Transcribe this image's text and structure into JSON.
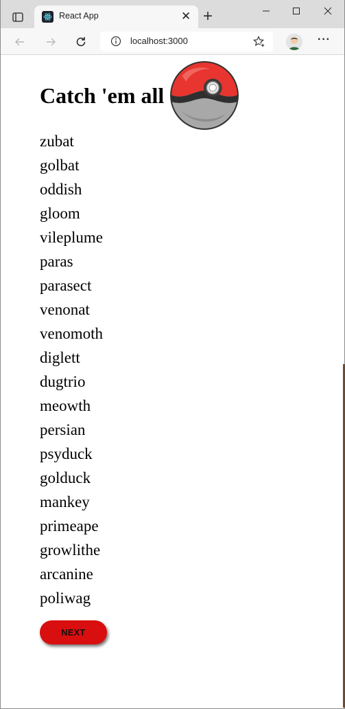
{
  "browser": {
    "tab_title": "React App",
    "url": "localhost:3000"
  },
  "page": {
    "title": "Catch 'em all",
    "pokemon": [
      "zubat",
      "golbat",
      "oddish",
      "gloom",
      "vileplume",
      "paras",
      "parasect",
      "venonat",
      "venomoth",
      "diglett",
      "dugtrio",
      "meowth",
      "persian",
      "psyduck",
      "golduck",
      "mankey",
      "primeape",
      "growlithe",
      "arcanine",
      "poliwag"
    ],
    "next_label": "NEXT"
  },
  "colors": {
    "next_button": "#d90e0e",
    "pokeball_red": "#e8352f",
    "pokeball_grey": "#9a9a9a"
  }
}
